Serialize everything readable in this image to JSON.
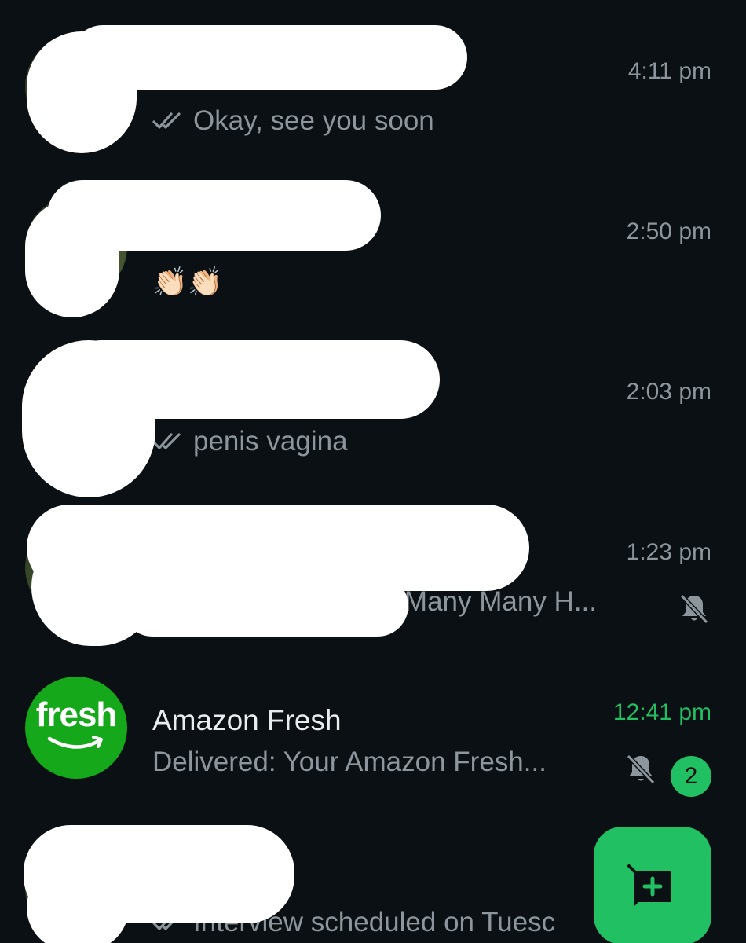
{
  "chats": [
    {
      "name": "",
      "time": "4:11 pm",
      "preview": "Okay, see you soon",
      "read_receipt": true
    },
    {
      "name": "",
      "time": "2:50 pm",
      "preview": "👏🏻👏🏻",
      "read_receipt": false
    },
    {
      "name": "",
      "time": "2:03 pm",
      "preview": "penis vagina",
      "read_receipt": true
    },
    {
      "name": "",
      "time": "1:23 pm",
      "preview": ": Many Many H...",
      "read_receipt": false,
      "muted": true
    },
    {
      "name": "Amazon Fresh",
      "time": "12:41 pm",
      "preview": "Delivered: Your Amazon Fresh...",
      "read_receipt": false,
      "muted": true,
      "unread_count": "2",
      "avatar_text": "fresh"
    },
    {
      "name": "",
      "time": "",
      "preview": "Interview scheduled on Tuesc",
      "read_receipt": true
    }
  ],
  "icons": {
    "read_receipt": "double-check-icon",
    "mute": "bell-muted-icon",
    "fab": "new-chat-icon"
  },
  "colors": {
    "background": "#0b1014",
    "accent": "#21c063",
    "secondary_text": "#8d969c",
    "fresh_brand": "#14a81a"
  }
}
